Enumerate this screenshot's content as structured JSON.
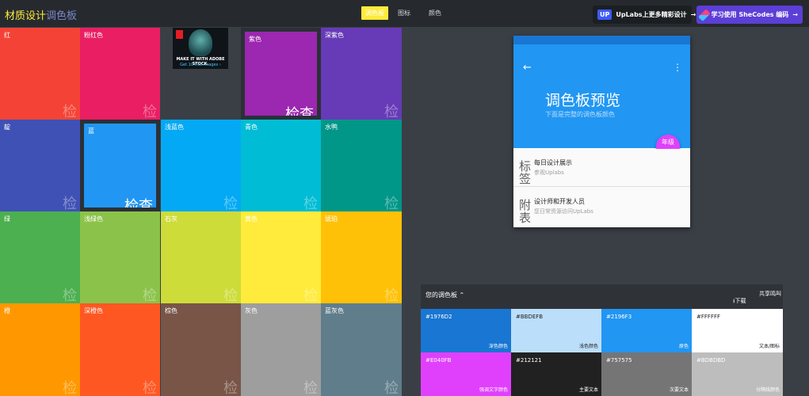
{
  "header": {
    "logo_part1": "材质设计",
    "logo_part2": "调色板",
    "nav": [
      "调色板",
      "图标",
      "颜色"
    ],
    "promo1": {
      "badge": "UP",
      "text": "UpLabs上更多精彩设计"
    },
    "promo2": {
      "text": "学习使用 SheCodes 编码"
    },
    "arrow": "→"
  },
  "tiles": [
    {
      "label": "红",
      "color": "#f44336",
      "check": "检"
    },
    {
      "label": "粉红色",
      "color": "#e91e63",
      "check": "检"
    },
    {
      "label": "",
      "color": "#3a3f45",
      "check": ""
    },
    {
      "label": "紫色",
      "color": "#9c27b0",
      "check": "检查"
    },
    {
      "label": "深紫色",
      "color": "#673ab7",
      "check": "检"
    },
    {
      "label": "靛",
      "color": "#3f51b5",
      "check": "检"
    },
    {
      "label": "蓝",
      "color": "#2196f3",
      "check": "检查"
    },
    {
      "label": "浅蓝色",
      "color": "#03a9f4",
      "check": "检"
    },
    {
      "label": "青色",
      "color": "#00bcd4",
      "check": "检"
    },
    {
      "label": "水鸭",
      "color": "#009688",
      "check": "检"
    },
    {
      "label": "绿",
      "color": "#4caf50",
      "check": "检"
    },
    {
      "label": "浅绿色",
      "color": "#8bc34a",
      "check": "检"
    },
    {
      "label": "石灰",
      "color": "#cddc39",
      "check": "检"
    },
    {
      "label": "黄色",
      "color": "#ffeb3b",
      "check": "检"
    },
    {
      "label": "琥珀",
      "color": "#ffc107",
      "check": "检"
    },
    {
      "label": "橙",
      "color": "#ff9800",
      "check": "检"
    },
    {
      "label": "深橙色",
      "color": "#ff5722",
      "check": "检"
    },
    {
      "label": "棕色",
      "color": "#795548",
      "check": "检"
    },
    {
      "label": "灰色",
      "color": "#9e9e9e",
      "check": "检"
    },
    {
      "label": "蓝灰色",
      "color": "#607d8b",
      "check": "检"
    }
  ],
  "ad": {
    "line1": "MAKE IT WITH ADOBE STOCK.",
    "line2": "Get 10 free images ›"
  },
  "preview": {
    "title": "调色板预览",
    "subtitle": "下面是完整的调色板颜色",
    "back_icon": "←",
    "more_icon": "⋮",
    "fab": "年级",
    "items": [
      {
        "icon": "标签",
        "title": "每日设计展示",
        "sub": "参观Uplabs"
      },
      {
        "icon": "附表",
        "title": "设计师和开发人员",
        "sub": "您日常资源访问UpLabs"
      }
    ]
  },
  "palette": {
    "title": "您的调色板",
    "caret": "⌃",
    "download": "下载",
    "download_icon": "⭳",
    "share": "共享鸣叫",
    "swatches": [
      {
        "hex": "#1976D2",
        "role": "深色颜色",
        "bg": "#1976d2",
        "fg": "#ffffff"
      },
      {
        "hex": "#BBDEFB",
        "role": "浅色颜色",
        "bg": "#bbdefb",
        "fg": "#212121"
      },
      {
        "hex": "#2196F3",
        "role": "原色",
        "bg": "#2196f3",
        "fg": "#ffffff"
      },
      {
        "hex": "#FFFFFF",
        "role": "文本/图标",
        "bg": "#ffffff",
        "fg": "#212121"
      },
      {
        "hex": "#E040FB",
        "role": "强调文字颜色",
        "bg": "#e040fb",
        "fg": "#ffffff"
      },
      {
        "hex": "#212121",
        "role": "主要文本",
        "bg": "#212121",
        "fg": "#ffffff"
      },
      {
        "hex": "#757575",
        "role": "次要文本",
        "bg": "#757575",
        "fg": "#ffffff"
      },
      {
        "hex": "#BDBDBD",
        "role": "分隔线颜色",
        "bg": "#bdbdbd",
        "fg": "#ffffff"
      }
    ]
  }
}
